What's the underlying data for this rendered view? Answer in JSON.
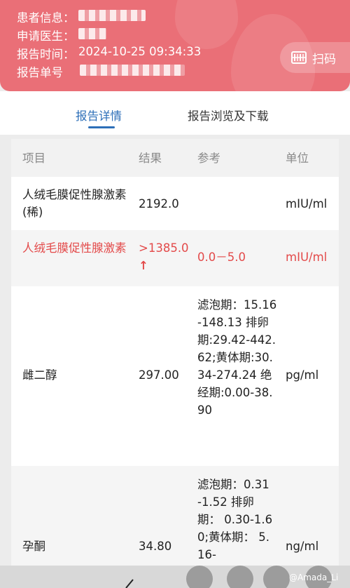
{
  "header": {
    "patient_label": "患者信息",
    "doctor_label": "申请医生",
    "time_label": "报告时间",
    "time_value": "2024-10-25 09:34:33",
    "id_label": "报告单号",
    "scan_label": "扫码"
  },
  "tabs": {
    "active": "报告详情",
    "inactive": "报告浏览及下载"
  },
  "table": {
    "headers": [
      "项目",
      "结果",
      "参考",
      "单位"
    ],
    "rows": [
      {
        "item": "人绒毛膜促性腺激素(稀)",
        "result": "2192.0",
        "reference": "",
        "unit": "mIU/ml",
        "abnormal": false
      },
      {
        "item": "人绒毛膜促性腺激素",
        "result": ">1385.0",
        "flag": "↑",
        "reference": "0.0－5.0",
        "unit": "mIU/ml",
        "abnormal": true
      },
      {
        "item": "雌二醇",
        "result": "297.00",
        "reference": "滤泡期：15.16-148.13 排卵期:29.42-442.62;黄体期:30.34-274.24 绝经期:0.00-38.90",
        "unit": "pg/ml",
        "abnormal": false
      },
      {
        "item": "孕酮",
        "result": "34.80",
        "reference": "滤泡期：0.31-1.52 排卵期： 0.30-1.60;黄体期： 5.16-",
        "unit": "ng/ml",
        "abnormal": false
      }
    ]
  },
  "watermark": "@Amada_Li",
  "colors": {
    "header": "#ea6f77",
    "accent": "#2d6fb8",
    "abnormal": "#e34a4a"
  }
}
